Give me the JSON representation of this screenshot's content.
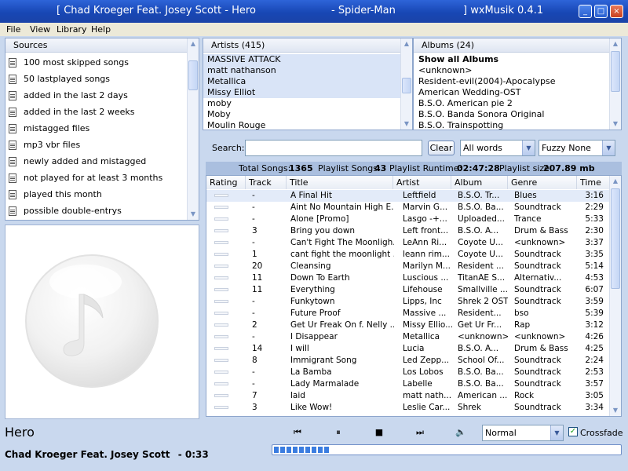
{
  "window": {
    "title_parts": [
      "[ Chad Kroeger Feat. Josey Scott - Hero",
      "- Spider-Man",
      "] wxMusik 0.4.1"
    ],
    "buttons": [
      "_",
      "□",
      "×"
    ]
  },
  "menu": [
    "File",
    "View",
    "Library",
    "Help"
  ],
  "sources": {
    "header": "Sources",
    "items": [
      "100 most skipped songs",
      "50 lastplayed songs",
      "added in the last 2 days",
      "added in the last 2 weeks",
      "mistagged files",
      "mp3 vbr files",
      "newly added and mistagged",
      "not played for at least 3 months",
      "played this month",
      "possible double-entrys"
    ]
  },
  "artists": {
    "header": "Artists (415)",
    "items": [
      "MASSIVE ATTACK",
      "matt nathanson",
      "Metallica",
      "Missy Elliot",
      "moby",
      "Moby",
      "Moulin Rouge"
    ],
    "selected": [
      0,
      1,
      2,
      3
    ]
  },
  "albums": {
    "header": "Albums (24)",
    "items": [
      "Show all Albums",
      "<unknown>",
      "Resident-evil(2004)-Apocalypse",
      "American Wedding-OST",
      "B.S.O. American pie 2",
      "B.S.O. Banda Sonora Original",
      "B.S.O. Trainspotting"
    ]
  },
  "search": {
    "label": "Search:",
    "value": "",
    "clear_label": "Clear",
    "mode": "All words",
    "fuzzy": "Fuzzy None"
  },
  "stats": {
    "total_songs_label": "Total Songs:",
    "total_songs": "1365",
    "playlist_songs_label": "Playlist Songs:",
    "playlist_songs": "43",
    "runtime_label": "Playlist Runtime:",
    "runtime": "02:47:28",
    "size_label": "Playlist size:",
    "size": "207.89 mb"
  },
  "table": {
    "columns": [
      "Rating",
      "Track",
      "Title",
      "Artist",
      "Album",
      "Genre",
      "Time"
    ],
    "rows": [
      {
        "track": "-",
        "title": "A Final Hit",
        "artist": "Leftfield",
        "album": "B.S.O. Tr...",
        "genre": "Blues",
        "time": "3:16"
      },
      {
        "track": "-",
        "title": "Aint No Mountain High E...",
        "artist": "Marvin G...",
        "album": "B.S.O. Ba...",
        "genre": "Soundtrack",
        "time": "2:29"
      },
      {
        "track": "-",
        "title": "Alone [Promo]",
        "artist": "Lasgo -+...",
        "album": "Uploaded...",
        "genre": "Trance",
        "time": "5:33"
      },
      {
        "track": "3",
        "title": "Bring you down",
        "artist": "Left front...",
        "album": "B.S.O. A...",
        "genre": "Drum & Bass",
        "time": "2:30"
      },
      {
        "track": "-",
        "title": "Can't Fight The Moonligh...",
        "artist": "LeAnn Ri...",
        "album": "Coyote U...",
        "genre": "<unknown>",
        "time": "3:37"
      },
      {
        "track": "1",
        "title": "cant fight the moonlight ...",
        "artist": "leann rim...",
        "album": "Coyote U...",
        "genre": "Soundtrack",
        "time": "3:35"
      },
      {
        "track": "20",
        "title": "Cleansing",
        "artist": "Marilyn M...",
        "album": "Resident ...",
        "genre": "Soundtrack",
        "time": "5:14"
      },
      {
        "track": "11",
        "title": "Down To Earth",
        "artist": "Luscious ...",
        "album": "TitanAE S...",
        "genre": "Alternativ...",
        "time": "4:53"
      },
      {
        "track": "11",
        "title": "Everything",
        "artist": "Lifehouse",
        "album": "Smallville ...",
        "genre": "Soundtrack",
        "time": "6:07"
      },
      {
        "track": "-",
        "title": "Funkytown",
        "artist": "Lipps, Inc",
        "album": "Shrek 2 OST",
        "genre": "Soundtrack",
        "time": "3:59"
      },
      {
        "track": "-",
        "title": "Future Proof",
        "artist": "Massive ...",
        "album": "Resident...",
        "genre": "bso",
        "time": "5:39"
      },
      {
        "track": "2",
        "title": "Get Ur Freak On f. Nelly ...",
        "artist": "Missy Ellio...",
        "album": "Get Ur Fr...",
        "genre": "Rap",
        "time": "3:12"
      },
      {
        "track": "-",
        "title": "I Disappear",
        "artist": "Metallica",
        "album": "<unknown>",
        "genre": "<unknown>",
        "time": "4:26"
      },
      {
        "track": "14",
        "title": "I will",
        "artist": "Lucia",
        "album": "B.S.O. A...",
        "genre": "Drum & Bass",
        "time": "4:25"
      },
      {
        "track": "8",
        "title": "Immigrant Song",
        "artist": "Led Zepp...",
        "album": "School Of...",
        "genre": "Soundtrack",
        "time": "2:24"
      },
      {
        "track": "-",
        "title": "La Bamba",
        "artist": "Los Lobos",
        "album": "B.S.O. Ba...",
        "genre": "Soundtrack",
        "time": "2:53"
      },
      {
        "track": "-",
        "title": "Lady Marmalade",
        "artist": "Labelle",
        "album": "B.S.O. Ba...",
        "genre": "Soundtrack",
        "time": "3:57"
      },
      {
        "track": "7",
        "title": "laid",
        "artist": "matt nath...",
        "album": "American ...",
        "genre": "Rock",
        "time": "3:05"
      },
      {
        "track": "3",
        "title": "Like Wow!",
        "artist": "Leslie Car...",
        "album": "Shrek",
        "genre": "Soundtrack",
        "time": "3:34"
      }
    ]
  },
  "now_playing": {
    "title": "Hero",
    "artist": "Chad Kroeger Feat. Josey Scott",
    "elapsed": "- 0:33",
    "progress": 0.16
  },
  "player": {
    "prev_icon": "⏮",
    "pause_icon": "⏸",
    "stop_icon": "■",
    "next_icon": "⏭",
    "volume_icon": "🔈",
    "mode": "Normal",
    "crossfade_label": "Crossfade",
    "crossfade_checked": true
  },
  "colors": {
    "accent": "#3b7de0",
    "titlebar": "#1847b5",
    "selection": "#e3ebf9"
  }
}
